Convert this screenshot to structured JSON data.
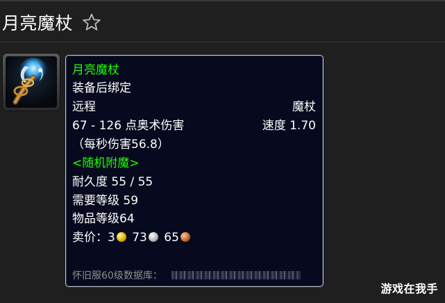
{
  "page": {
    "title": "月亮魔杖",
    "favorite_icon": "star-outline-icon"
  },
  "item_icon": "moon-wand-icon",
  "tooltip": {
    "name": "月亮魔杖",
    "bind": "装备后绑定",
    "slot": "远程",
    "type": "魔杖",
    "damage": "67 - 126 点奥术伤害",
    "speed": "速度 1.70",
    "dps": "（每秒伤害56.8）",
    "enchant": "<随机附魔>",
    "durability": "耐久度 55 / 55",
    "required_level": "需要等级 59",
    "item_level": "物品等级64",
    "sell_label": "卖价：",
    "sell_gold": "3",
    "sell_silver": "73",
    "sell_copper": "65",
    "database": "怀旧服60级数据库："
  },
  "watermark": "游戏在我手",
  "colors": {
    "background": "#1f1f1f",
    "tooltip_bg": "#070a1e",
    "tooltip_border": "#c7c7c7",
    "green_text": "#1eff00",
    "db_text": "#8f8f8f"
  }
}
